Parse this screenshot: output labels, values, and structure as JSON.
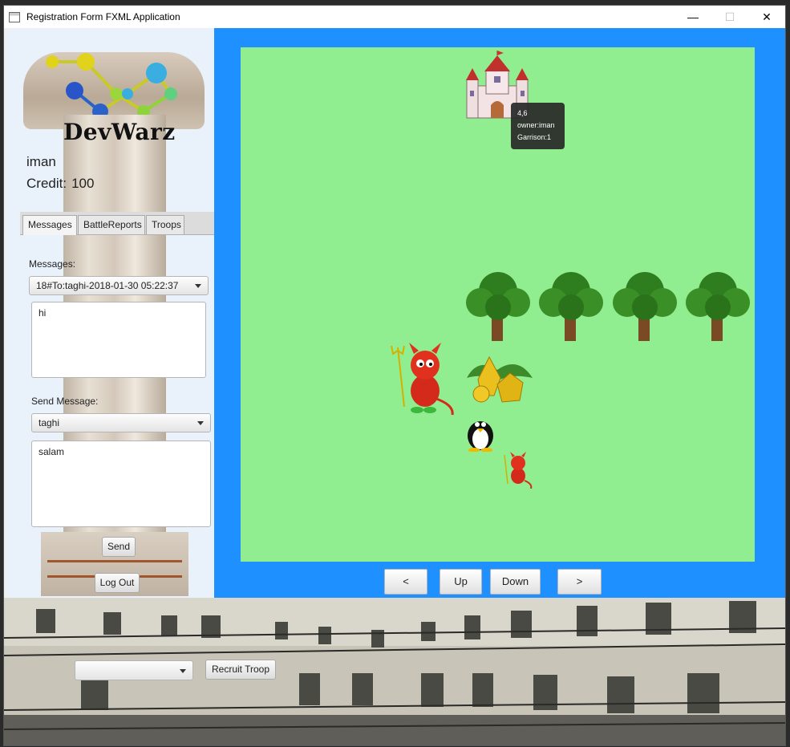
{
  "window": {
    "title": "Registration Form FXML Application",
    "close_glyph": "✕",
    "maximize_glyph": "☐",
    "minimize_glyph": "—"
  },
  "brand": {
    "name": "DevWarz"
  },
  "player": {
    "username": "iman",
    "credit_label": "Credit:",
    "credit_value": "100"
  },
  "tabs": [
    {
      "label": "Messages",
      "active": true
    },
    {
      "label": "BattleReports",
      "active": false
    },
    {
      "label": "Troops",
      "active": false
    }
  ],
  "messages": {
    "label": "Messages:",
    "selected": "18#To:taghi-2018-01-30 05:22:37",
    "body": "hi"
  },
  "send": {
    "label": "Send Message:",
    "recipient": "taghi",
    "body": "salam",
    "send_button": "Send"
  },
  "logout_button": "Log Out",
  "nav": {
    "left": "<",
    "up": "Up",
    "down": "Down",
    "right": ">"
  },
  "tooltip": {
    "coords": "4,6",
    "owner": "owner:iman",
    "garrison": "Garrison:1"
  },
  "recruit": {
    "selected": "",
    "button": "Recruit Troop"
  },
  "colors": {
    "board": "#90ee90",
    "game_bg": "#1e90ff"
  },
  "map_objects": [
    "castle-icon",
    "tree-icon",
    "tree-icon",
    "tree-icon",
    "tree-icon",
    "devil-icon",
    "gold-icon",
    "penguin-icon",
    "small-devil-icon"
  ]
}
